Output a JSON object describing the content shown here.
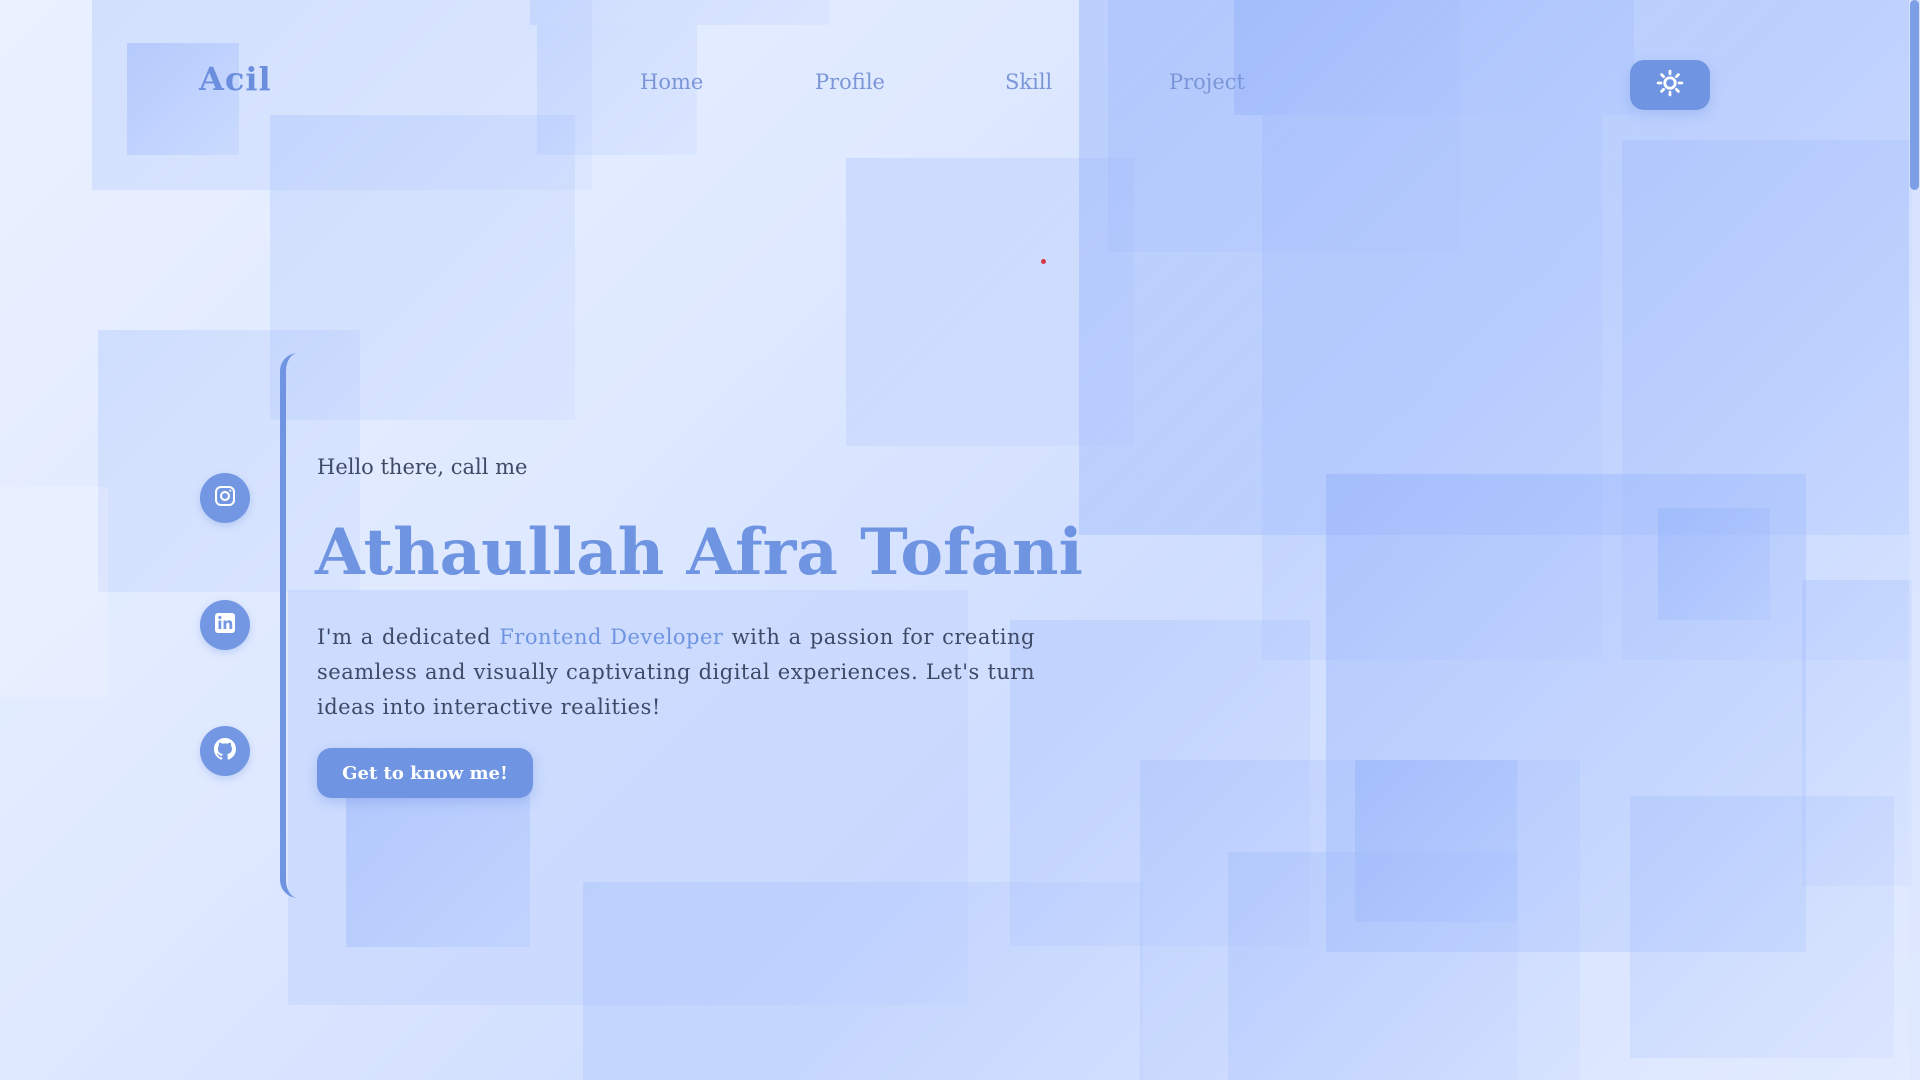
{
  "header": {
    "logo": "Acil",
    "nav": [
      {
        "label": "Home"
      },
      {
        "label": "Profile"
      },
      {
        "label": "Skill"
      },
      {
        "label": "Project"
      }
    ],
    "theme_toggle_icon": "sun-icon"
  },
  "socials": [
    {
      "icon": "instagram-icon"
    },
    {
      "icon": "linkedin-icon"
    },
    {
      "icon": "github-icon"
    }
  ],
  "hero": {
    "greeting": "Hello there, call me",
    "name": "Athaullah Afra Tofani",
    "description_before": "I'm a dedicated ",
    "description_highlight": "Frontend Developer",
    "description_after": " with a passion for creating seamless and visually captivating digital experiences. Let's turn ideas into interactive realities!",
    "cta_label": "Get to know me!"
  },
  "colors": {
    "accent": "#6f95e2",
    "text": "#3e4a66",
    "background": "#dfe9ff"
  }
}
